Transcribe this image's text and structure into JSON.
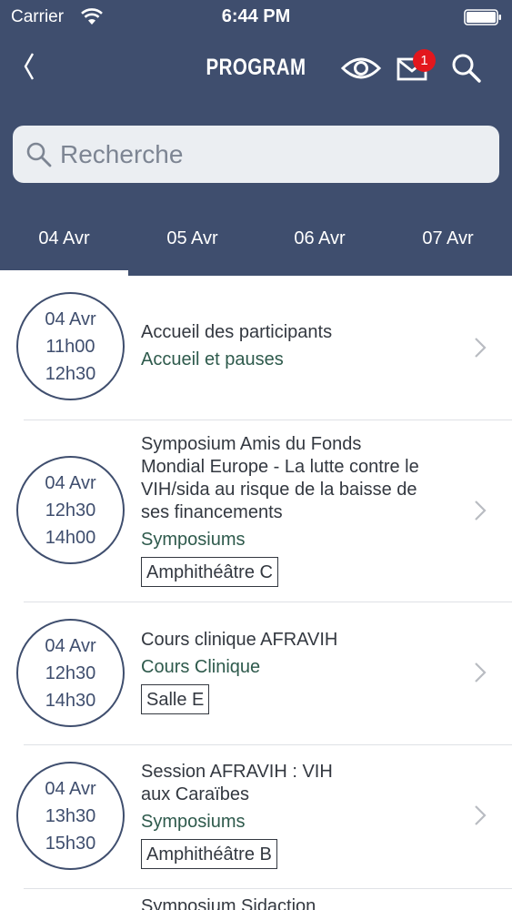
{
  "status_bar": {
    "carrier": "Carrier",
    "time": "6:44 PM"
  },
  "nav": {
    "title": "PROGRAM",
    "mail_badge": "1"
  },
  "search": {
    "placeholder": "Recherche"
  },
  "tabs": [
    {
      "label": "04 Avr",
      "selected": true
    },
    {
      "label": "05 Avr",
      "selected": false
    },
    {
      "label": "06 Avr",
      "selected": false
    },
    {
      "label": "07 Avr",
      "selected": false
    }
  ],
  "events": [
    {
      "date": "04 Avr",
      "start": "11h00",
      "end": "12h30",
      "title": "Accueil des participants",
      "category": "Accueil et pauses",
      "room": ""
    },
    {
      "date": "04 Avr",
      "start": "12h30",
      "end": "14h00",
      "title": "Symposium Amis du Fonds Mondial Europe - La lutte contre le VIH/sida au risque de la baisse de ses financements",
      "category": "Symposiums",
      "room": "Amphithéâtre C"
    },
    {
      "date": "04 Avr",
      "start": "12h30",
      "end": "14h30",
      "title": "Cours clinique AFRAVIH",
      "category": "Cours Clinique",
      "room": "Salle E"
    },
    {
      "date": "04 Avr",
      "start": "13h30",
      "end": "15h30",
      "title": "Session AFRAVIH : VIH aux Caraïbes",
      "category": "Symposiums",
      "room": "Amphithéâtre B"
    }
  ],
  "next_item_peek": "Symposium Sidaction",
  "colors": {
    "header": "#3f4e6e",
    "category": "#2e5a4c",
    "badge": "#e3171d"
  }
}
